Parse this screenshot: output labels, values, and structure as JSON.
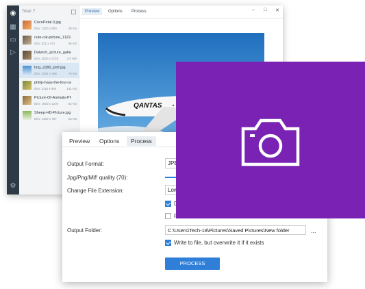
{
  "back_window": {
    "total_label": "Total:",
    "total_count": "7",
    "tabs": [
      "Preview",
      "Options",
      "Process"
    ],
    "window_controls": {
      "minimize": "–",
      "maximize": "□",
      "close": "✕"
    },
    "files": [
      {
        "name": "CocoPetal.0.jpg",
        "dims": "Dim: 1200 x 800",
        "size": "48 KB"
      },
      {
        "name": "cute-cat-picture_1122-...",
        "dims": "Dim: 521 x 472",
        "size": "36 KB"
      },
      {
        "name": "Dulwich_picture_gallery...",
        "dims": "Dim: 3530 x 2725",
        "size": "3.0 MB"
      },
      {
        "name": "Img_a380_pmf.jpg",
        "dims": "Dim: 1024 x 768",
        "size": "75 KB"
      },
      {
        "name": "philip-haas-the-four-se...",
        "dims": "Dim: 3116 x 964",
        "size": "131 KB"
      },
      {
        "name": "Picture-Of-Animals-Ph...",
        "dims": "Dim: 1600 x 1200",
        "size": "52 KB"
      },
      {
        "name": "Sheep-HD-Picture.jpg",
        "dims": "Dim: 1400 x 787",
        "size": "53 KB"
      }
    ],
    "active_file_index": 3,
    "plane_livery": "QANTAS"
  },
  "front_window": {
    "tabs": [
      "Preview",
      "Options",
      "Process"
    ],
    "selected_tab": "Process",
    "output_format_label": "Output Format:",
    "output_format_value": "JPEG",
    "quality_label": "Jpg/Png/Mif! quality (70):",
    "quality_value": 70,
    "change_ext_label": "Change File Extension:",
    "change_ext_value": "Low",
    "check1_label": "D",
    "check1_checked": true,
    "check2_label": "R",
    "check2_checked": false,
    "output_folder_label": "Output Folder:",
    "output_folder_value": "C:\\Users\\Tech-18\\Pictures\\Saved Pictures\\New folder",
    "browse_label": "...",
    "overwrite_label": "Write to file, but overwrite it if it exists",
    "overwrite_checked": true,
    "process_button_label": "PROCESS"
  },
  "overlay": {
    "icon": "camera-icon",
    "background_color": "#7a22b4"
  }
}
